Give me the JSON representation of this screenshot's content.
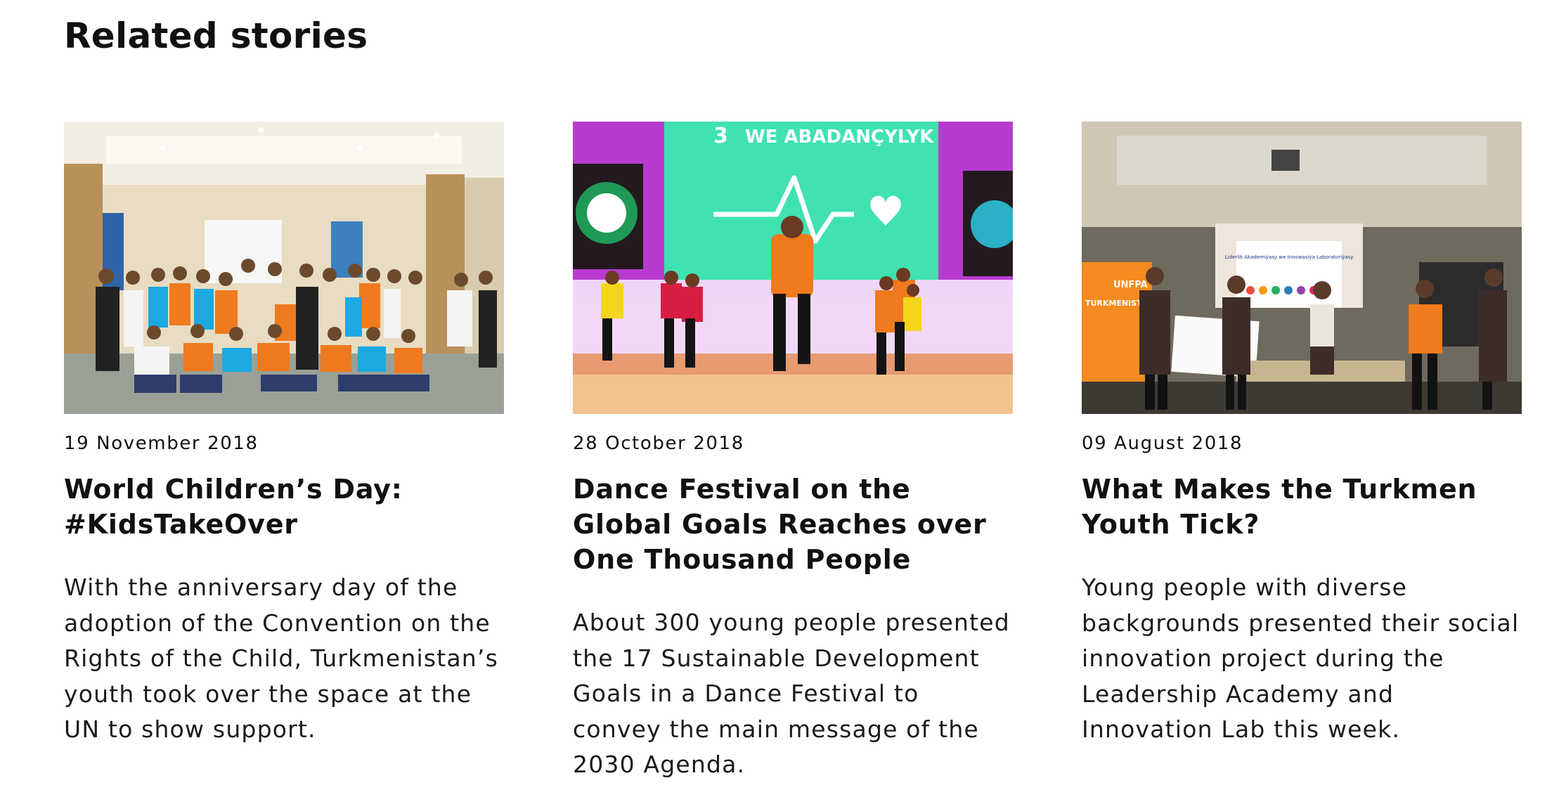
{
  "section": {
    "title": "Related stories"
  },
  "stories": [
    {
      "date": "19 November 2018",
      "title": "World Children’s Day: #KidsTakeOver",
      "summary": "With the anniversary day of the adoption of the Convention on the Rights of the Child, Turkmenistan’s youth took over the space at the UN to show support."
    },
    {
      "date": "28 October 2018",
      "title": "Dance Festival on the Global Goals Reaches over One Thousand People",
      "summary": "About 300 young people presented the 17 Sustainable Development Goals in a Dance Festival to convey the main message of the 2030 Agenda.",
      "image_text": {
        "screen_banner": "WE ABADANÇYLYK",
        "screen_number": "3"
      }
    },
    {
      "date": "09 August 2018",
      "title": "What Makes the Turkmen Youth Tick?",
      "summary": "Young people with diverse backgrounds presented their social innovation project during the Leadership Academy and Innovation Lab this week.",
      "image_text": {
        "banner_label": "UNFPA",
        "banner_country": "TURKMENISTAN",
        "screen_title": "Liderlik Akademiýasy we Innowasiýa Laboratoriýasy"
      }
    }
  ],
  "colors": {
    "text": "#111111",
    "background": "#ffffff",
    "unicef_cyan": "#1ca9e1",
    "orange_shirt": "#f07a1e",
    "stage_green": "#3fe2b0",
    "stage_magenta": "#e23fd0",
    "unfpa_orange": "#f38b20"
  }
}
